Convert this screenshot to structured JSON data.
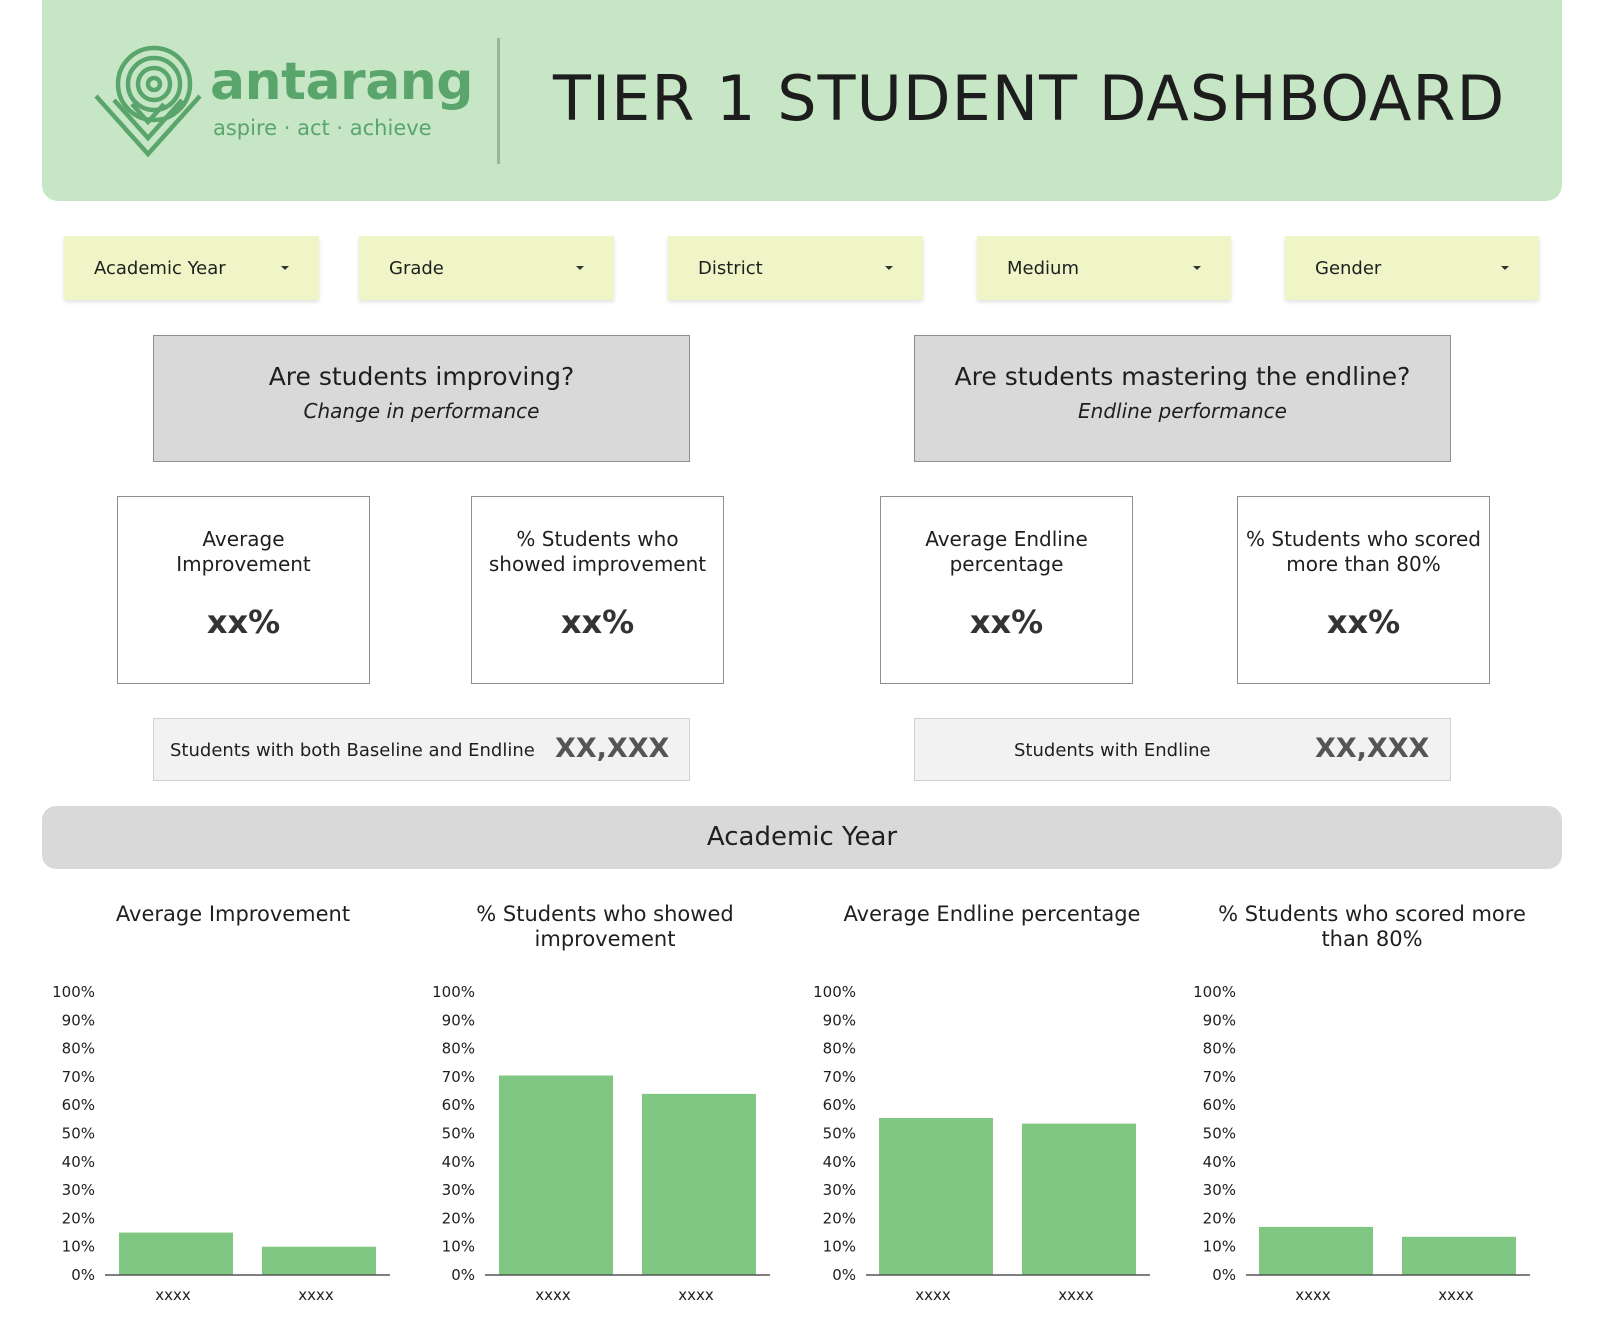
{
  "header": {
    "brand_name": "antarang",
    "brand_tagline": "aspire · act · achieve",
    "title": "TIER 1 STUDENT DASHBOARD",
    "logo_icon": "triangle-spiral-logo-icon"
  },
  "filters": [
    {
      "label": "Academic Year"
    },
    {
      "label": "Grade"
    },
    {
      "label": "District"
    },
    {
      "label": "Medium"
    },
    {
      "label": "Gender"
    }
  ],
  "sections": {
    "improving": {
      "question": "Are students improving?",
      "subtitle": "Change in performance",
      "cards": [
        {
          "label": "Average Improvement",
          "value": "xx%"
        },
        {
          "label": "% Students who showed improvement",
          "value": "xx%"
        }
      ],
      "count": {
        "label": "Students with both Baseline and Endline",
        "value": "XX,XXX"
      }
    },
    "mastering": {
      "question": "Are students mastering the endline?",
      "subtitle": "Endline performance",
      "cards": [
        {
          "label": "Average Endline percentage",
          "value": "xx%"
        },
        {
          "label": "% Students who scored more than 80%",
          "value": "xx%"
        }
      ],
      "count": {
        "label": "Students with Endline",
        "value": "XX,XXX"
      }
    }
  },
  "year_bar": {
    "label": "Academic Year"
  },
  "colors": {
    "bar": "#81c784",
    "header_bg": "#c6e6c6",
    "filter_bg": "#eff5c6",
    "brand": "#5aa56c"
  },
  "chart_data": [
    {
      "type": "bar",
      "title": "Average Improvement",
      "categories": [
        "xxxx",
        "xxxx"
      ],
      "values": [
        15,
        10
      ],
      "ylim": [
        0,
        100
      ],
      "yticks": [
        "0%",
        "10%",
        "20%",
        "30%",
        "40%",
        "50%",
        "60%",
        "70%",
        "80%",
        "90%",
        "100%"
      ]
    },
    {
      "type": "bar",
      "title": "% Students who showed improvement",
      "categories": [
        "xxxx",
        "xxxx"
      ],
      "values": [
        70.5,
        64
      ],
      "ylim": [
        0,
        100
      ],
      "yticks": [
        "0%",
        "10%",
        "20%",
        "30%",
        "40%",
        "50%",
        "60%",
        "70%",
        "80%",
        "90%",
        "100%"
      ]
    },
    {
      "type": "bar",
      "title": "Average Endline percentage",
      "categories": [
        "xxxx",
        "xxxx"
      ],
      "values": [
        55.5,
        53.5
      ],
      "ylim": [
        0,
        100
      ],
      "yticks": [
        "0%",
        "10%",
        "20%",
        "30%",
        "40%",
        "50%",
        "60%",
        "70%",
        "80%",
        "90%",
        "100%"
      ]
    },
    {
      "type": "bar",
      "title": "% Students who scored more than 80%",
      "categories": [
        "xxxx",
        "xxxx"
      ],
      "values": [
        17,
        13.5
      ],
      "ylim": [
        0,
        100
      ],
      "yticks": [
        "0%",
        "10%",
        "20%",
        "30%",
        "40%",
        "50%",
        "60%",
        "70%",
        "80%",
        "90%",
        "100%"
      ]
    }
  ]
}
